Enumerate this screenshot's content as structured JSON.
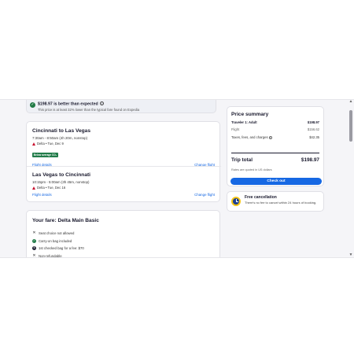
{
  "banner": {
    "title": "$198.97 is better than expected",
    "info_icon": "info-icon",
    "subtitle": "This price is at least 32% lower than the typical fare found on Expedia"
  },
  "flights": [
    {
      "route": "Cincinnati to Las Vegas",
      "times": "7:30am - 8:50am (4h 20m, nonstop)",
      "airline": "Delta • Tue, Dec 9",
      "badge": "Below average CO₂",
      "details_link": "Flight details",
      "change_link": "Change flight"
    },
    {
      "route": "Las Vegas to Cincinnati",
      "times": "10:15pm - 5:00am (3h 45m, nonstop)",
      "airline": "Delta • Tue, Dec 16",
      "details_link": "Flight details",
      "change_link": "Change flight"
    }
  ],
  "fare": {
    "title": "Your fare: Delta Main Basic",
    "items": [
      {
        "icon": "x-icon",
        "text": "Seat choice not allowed"
      },
      {
        "icon": "check-icon",
        "text": "Carry-on bag included"
      },
      {
        "icon": "dollar-icon",
        "text": "1st checked bag for a fee: $70"
      },
      {
        "icon": "x-icon",
        "text": "Non-refundable"
      }
    ]
  },
  "summary": {
    "title": "Price summary",
    "traveler_label": "Traveler 1: Adult",
    "traveler_value": "$198.97",
    "flight_label": "Flight",
    "flight_value": "$156.62",
    "taxes_label": "Taxes, fees, and charges",
    "taxes_value": "$42.35",
    "total_label": "Trip total",
    "total_value": "$198.97",
    "note": "Rates are quoted in US dollars",
    "checkout_label": "Check out"
  },
  "cancellation": {
    "title": "Free cancellation",
    "text": "There's no fee to cancel within 24 hours of booking."
  },
  "colors": {
    "accent": "#1668e3",
    "success": "#227c4a",
    "delta_red": "#c8102e",
    "clock_yellow": "#f5c518",
    "clock_blue": "#1d3f91"
  }
}
